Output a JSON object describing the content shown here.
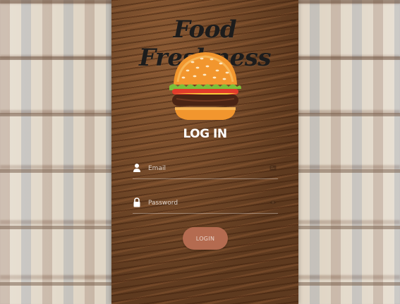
{
  "app": {
    "title": "Food Freshness"
  },
  "login": {
    "heading": "LOG IN",
    "email_placeholder": "Email",
    "password_placeholder": "Password",
    "button_label": "LOGIN"
  },
  "icons": {
    "email": "user-icon",
    "password": "lock-icon",
    "email_right": "id-card-icon",
    "password_right": "eye-icon",
    "logo": "burger-icon"
  },
  "colors": {
    "panel": "#6b4425",
    "button": "#b46b50",
    "title": "#1c1c1c",
    "heading": "#ffffff"
  }
}
